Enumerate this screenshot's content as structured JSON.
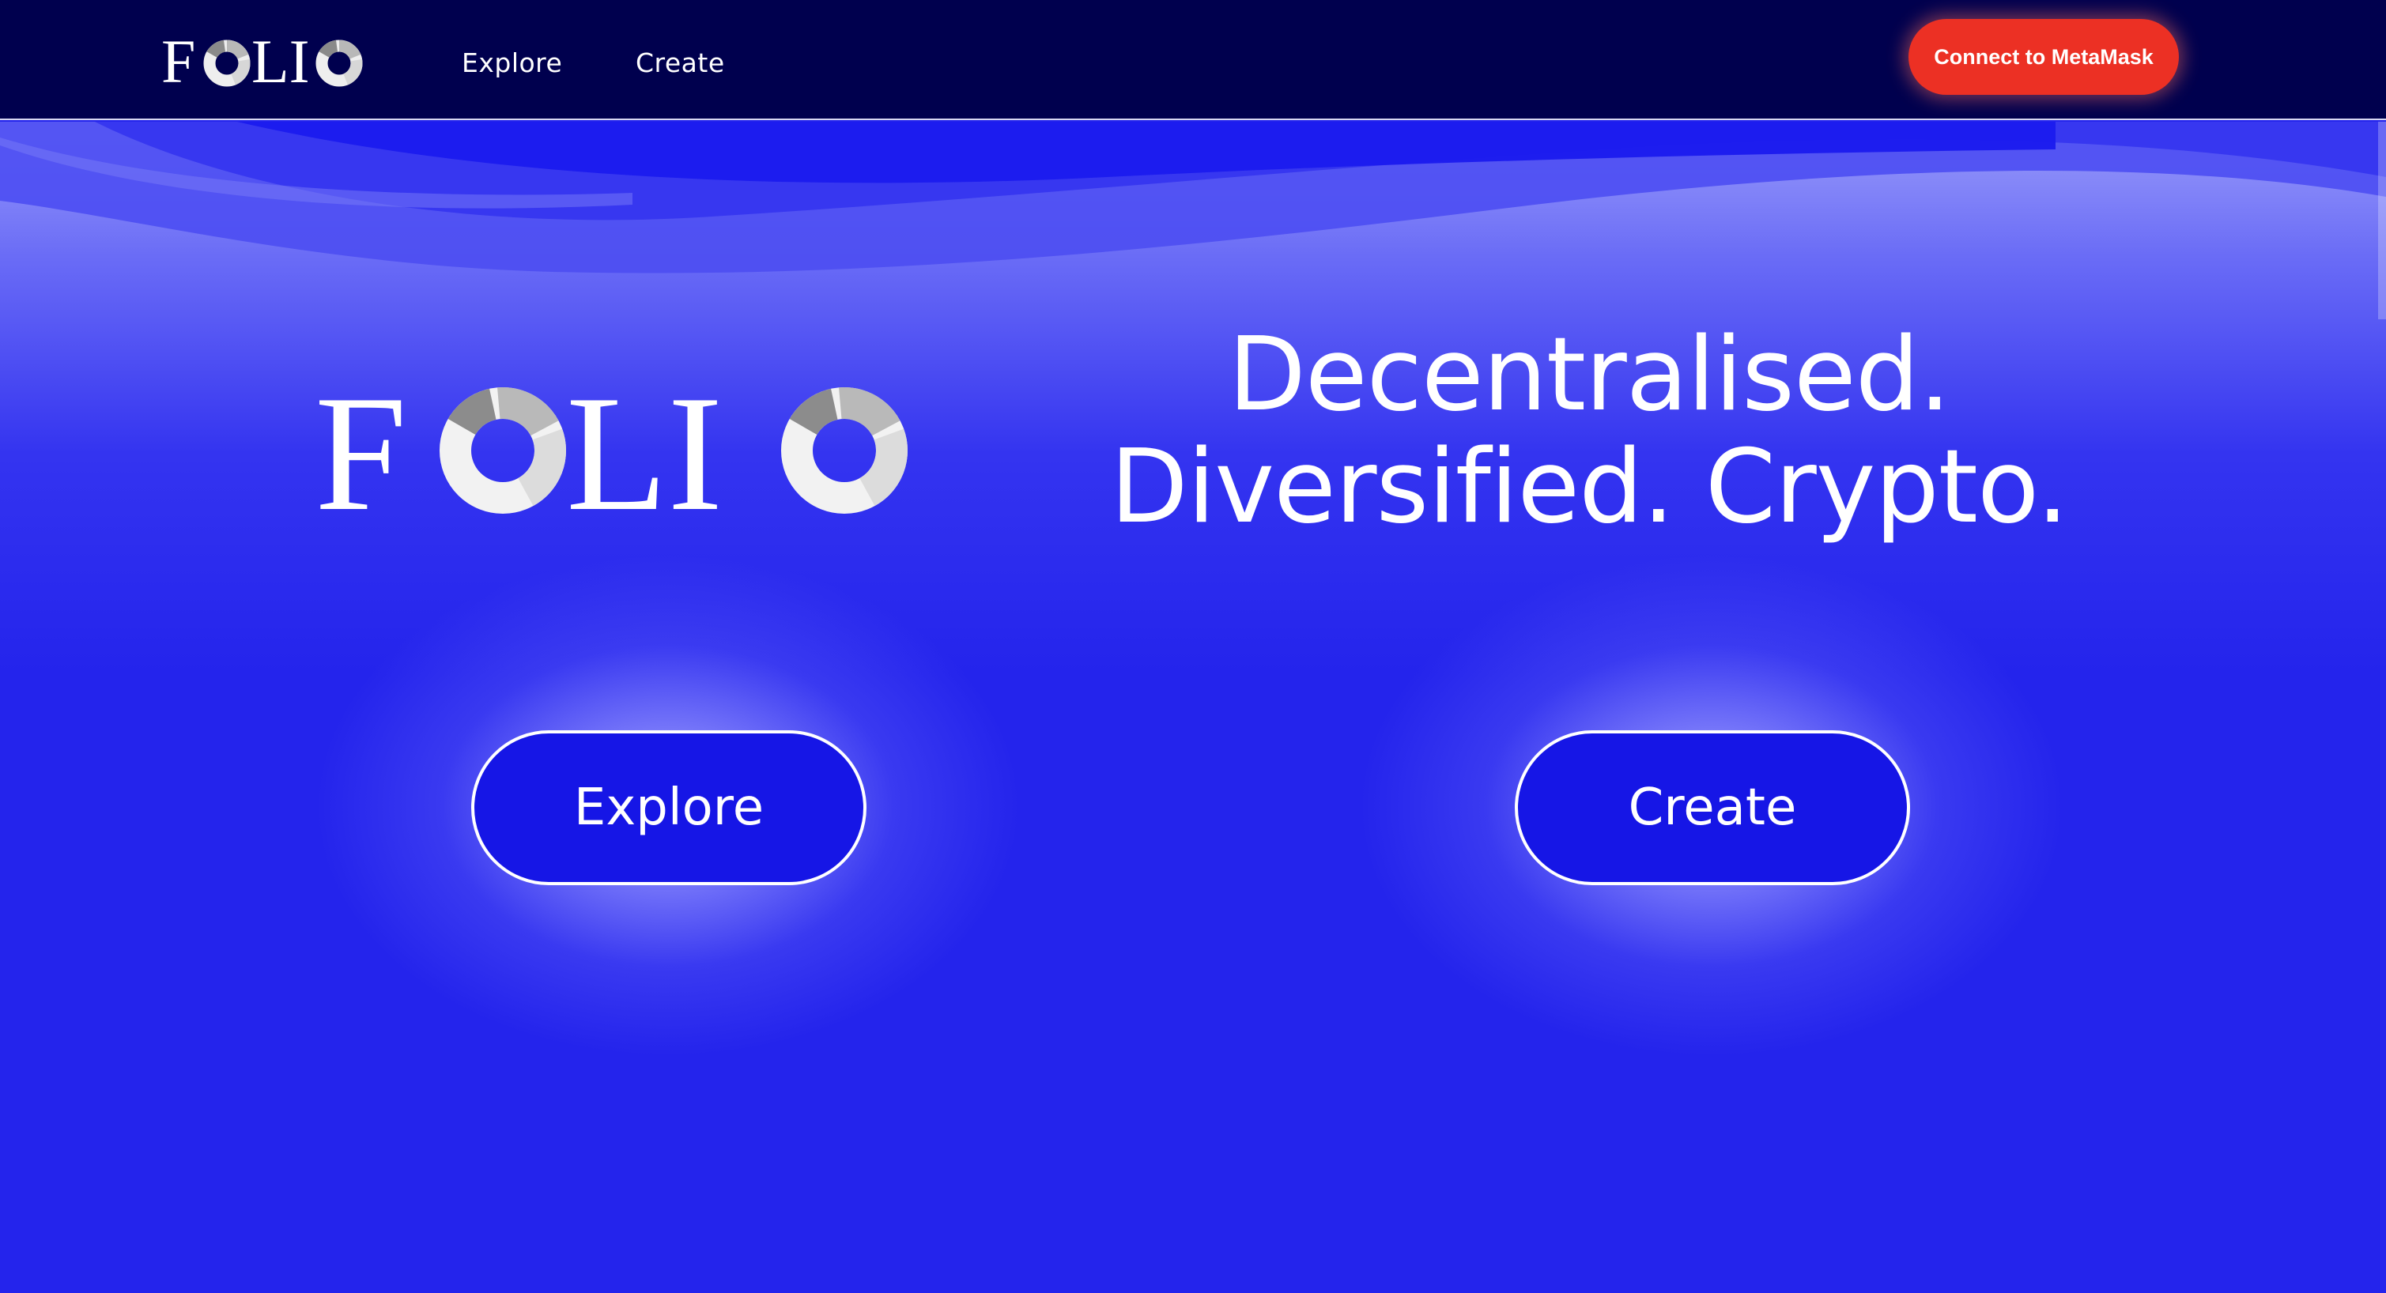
{
  "app": {
    "brand": "FOLIO"
  },
  "nav": {
    "links": [
      {
        "label": "Explore"
      },
      {
        "label": "Create"
      }
    ],
    "connect_label": "Connect to MetaMask"
  },
  "hero": {
    "brand": "FOLIO",
    "tagline_line1": "Decentralised.",
    "tagline_line2": "Diversified. Crypto.",
    "buttons": {
      "explore_label": "Explore",
      "create_label": "Create"
    }
  },
  "colors": {
    "nav_background": "#00004e",
    "hero_background": "#2424ec",
    "connect_button": "#ec3024",
    "cta_button": "#1616e6",
    "text": "#ffffff"
  },
  "icons": {
    "logo_rings": "donut-chart-icon"
  }
}
